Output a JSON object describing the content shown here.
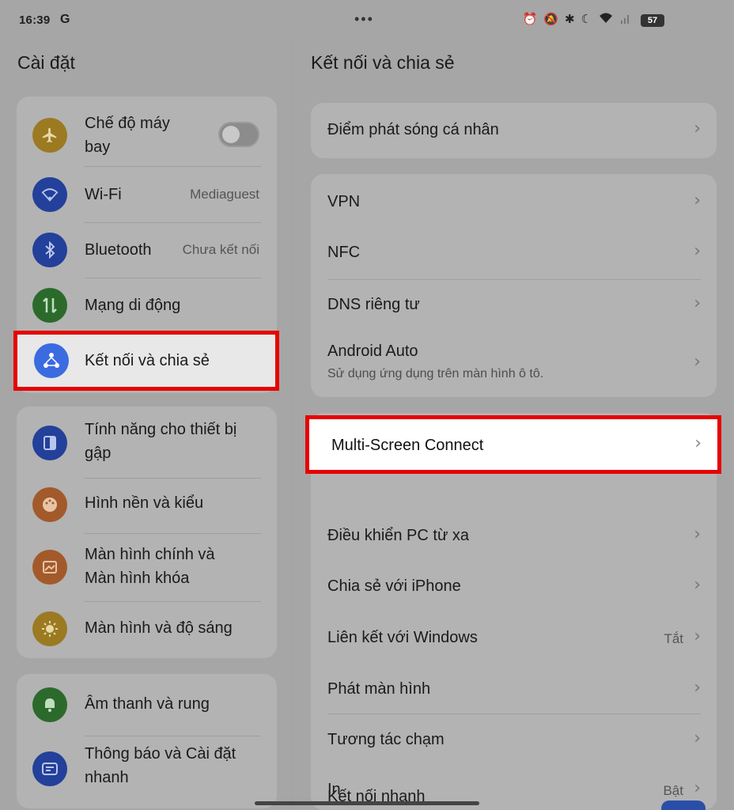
{
  "status": {
    "time": "16:39",
    "g_logo": "G",
    "dots": "•••",
    "icons": [
      "alarm-icon",
      "bell-off-icon",
      "bluetooth-icon",
      "moon-icon",
      "wifi-icon",
      "signal-icon"
    ],
    "battery": "57"
  },
  "left": {
    "title": "Cài đặt",
    "items": [
      {
        "label": "Chế độ máy\nbay",
        "icon": "airplane-icon",
        "color": "#9b7a22"
      },
      {
        "label": "Wi-Fi",
        "value": "Mediaguest",
        "icon": "wifi-icon",
        "color": "#23409a"
      },
      {
        "label": "Bluetooth",
        "value": "Chưa kết nối",
        "icon": "bluetooth-icon",
        "color": "#23409a"
      },
      {
        "label": "Mạng di động",
        "icon": "mobile-data-icon",
        "color": "#2c6a2c"
      },
      {
        "label": "Kết nối và chia sẻ",
        "icon": "share-connect-icon",
        "color": "#3a6be0"
      },
      {
        "label": "Tính năng cho thiết bị\ngập",
        "icon": "foldable-icon",
        "color": "#23409a"
      },
      {
        "label": "Hình nền và kiểu",
        "icon": "palette-icon",
        "color": "#a35a2a"
      },
      {
        "label": "Màn hình chính và\nMàn hình khóa",
        "icon": "home-screen-icon",
        "color": "#a35a2a"
      },
      {
        "label": "Màn hình và độ sáng",
        "icon": "brightness-icon",
        "color": "#9b7a22"
      },
      {
        "label": "Âm thanh và rung",
        "icon": "bell-icon",
        "color": "#2c6a2c"
      },
      {
        "label": "Thông báo và Cài đặt\nnhanh",
        "icon": "notification-icon",
        "color": "#23409a"
      }
    ]
  },
  "right": {
    "title": "Kết nối và chia sẻ",
    "items": [
      {
        "label": "Điểm phát sóng cá nhân"
      },
      {
        "label": "VPN"
      },
      {
        "label": "NFC"
      },
      {
        "label": "DNS riêng tư"
      },
      {
        "label": "Android Auto",
        "sub": "Sử dụng ứng dụng trên màn hình ô tô."
      },
      {
        "label": "Multi-Screen Connect"
      },
      {
        "label": "Điều khiển PC từ xa"
      },
      {
        "label": "Chia sẻ với iPhone"
      },
      {
        "label": "Liên kết với Windows",
        "value": "Tắt"
      },
      {
        "label": "Phát màn hình"
      },
      {
        "label": "Tương tác chạm"
      },
      {
        "label": "In",
        "value": "Bật"
      },
      {
        "label": "Kết nối nhanh"
      }
    ]
  },
  "chevron": "›"
}
